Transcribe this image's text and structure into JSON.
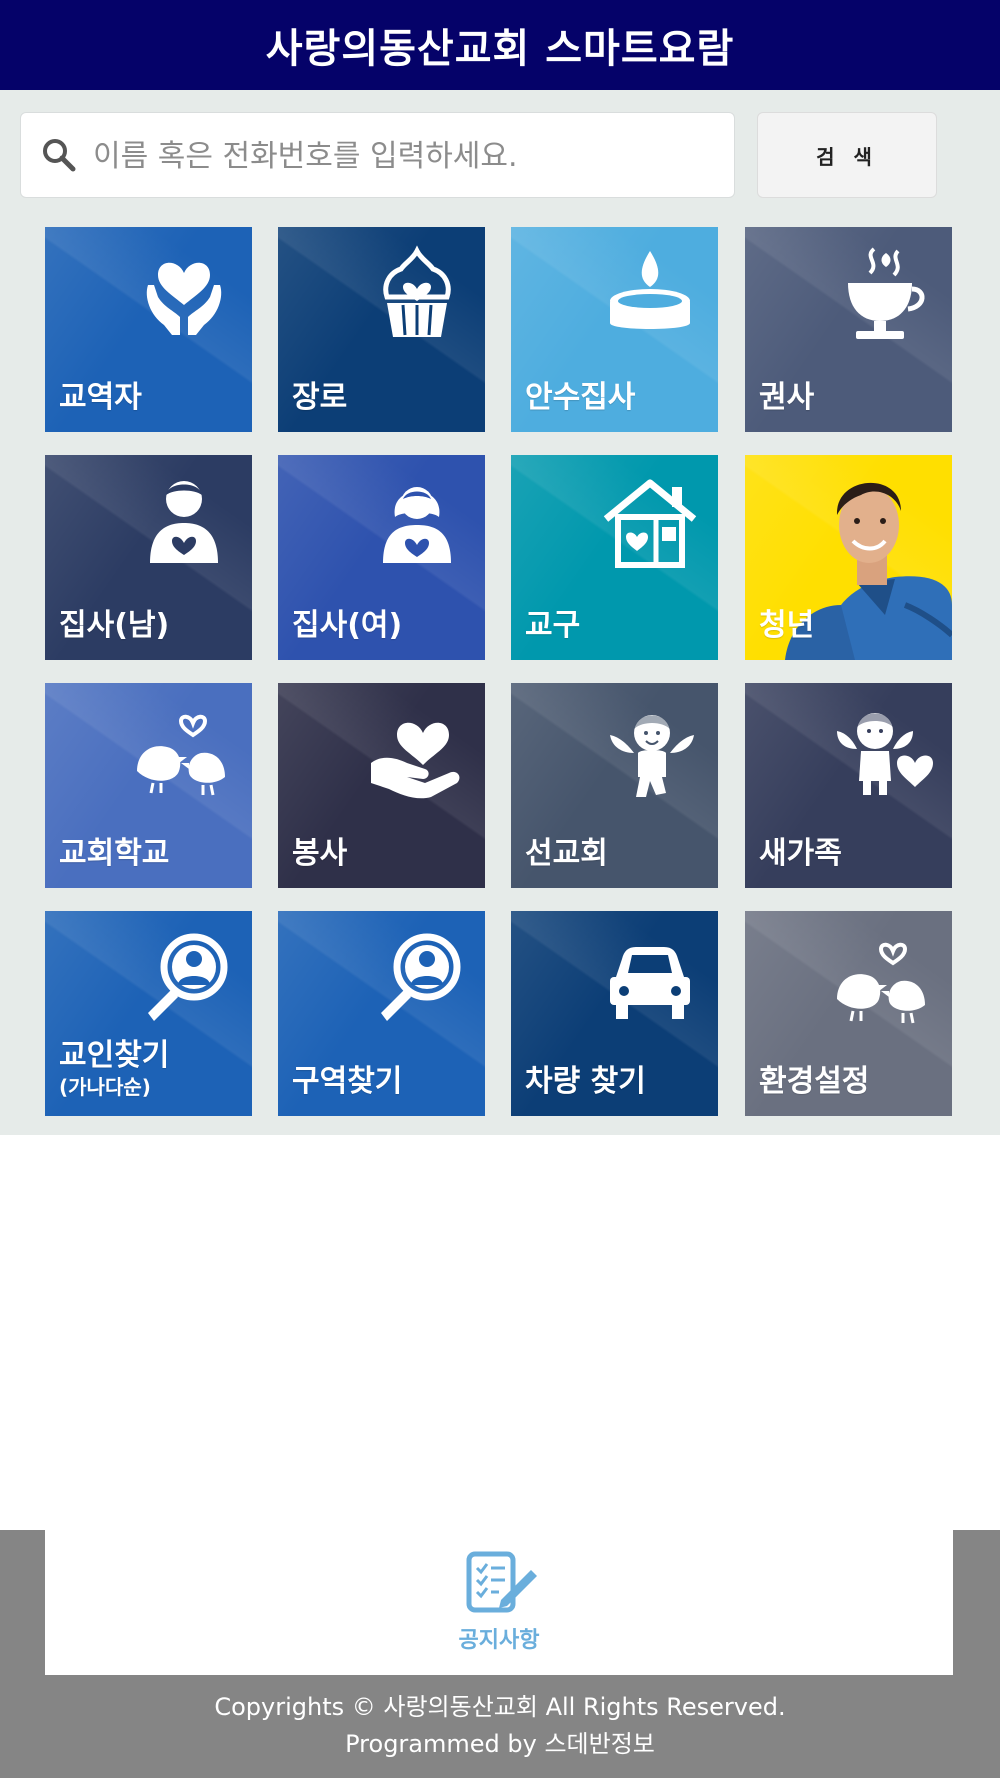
{
  "header": {
    "title": "사랑의동산교회 스마트요람"
  },
  "search": {
    "placeholder": "이름 혹은 전화번호를 입력하세요.",
    "value": "",
    "button_label": "검 색"
  },
  "tiles": [
    {
      "label": "교역자",
      "icon": "hands-heart-icon",
      "color": "#1d62b6"
    },
    {
      "label": "장로",
      "icon": "cupcake-heart-icon",
      "color": "#0c3e76"
    },
    {
      "label": "안수집사",
      "icon": "candle-icon",
      "color": "#4eaddf"
    },
    {
      "label": "권사",
      "icon": "coffee-cup-icon",
      "color": "#4d5b7a"
    },
    {
      "label": "집사(남)",
      "icon": "man-heart-icon",
      "color": "#2c3c63"
    },
    {
      "label": "집사(여)",
      "icon": "woman-heart-icon",
      "color": "#2e52ae"
    },
    {
      "label": "교구",
      "icon": "house-heart-icon",
      "color": "#0098ad"
    },
    {
      "label": "청년",
      "icon": "young-man-photo",
      "color": "#ffdf00"
    },
    {
      "label": "교회학교",
      "icon": "love-birds-icon",
      "color": "#4a6fbf"
    },
    {
      "label": "봉사",
      "icon": "hand-heart-icon",
      "color": "#2f3049"
    },
    {
      "label": "선교회",
      "icon": "cupid-icon",
      "color": "#46556c"
    },
    {
      "label": "새가족",
      "icon": "angel-heart-icon",
      "color": "#363e5c"
    },
    {
      "label": "교인찾기",
      "sub": "(가나다순)",
      "icon": "magnifier-person-icon",
      "color": "#1d62b6"
    },
    {
      "label": "구역찾기",
      "icon": "magnifier-person-icon",
      "color": "#1d62b6"
    },
    {
      "label": "차량 찾기",
      "icon": "car-icon",
      "color": "#0c3e76"
    },
    {
      "label": "환경설정",
      "icon": "love-birds-icon",
      "color": "#6a7080"
    }
  ],
  "notice": {
    "label": "공지사항",
    "icon": "notice-pencil-icon"
  },
  "footer": {
    "line1": "Copyrights © 사랑의동산교회 All Rights Reserved.",
    "line2": "Programmed by 스데반정보"
  }
}
